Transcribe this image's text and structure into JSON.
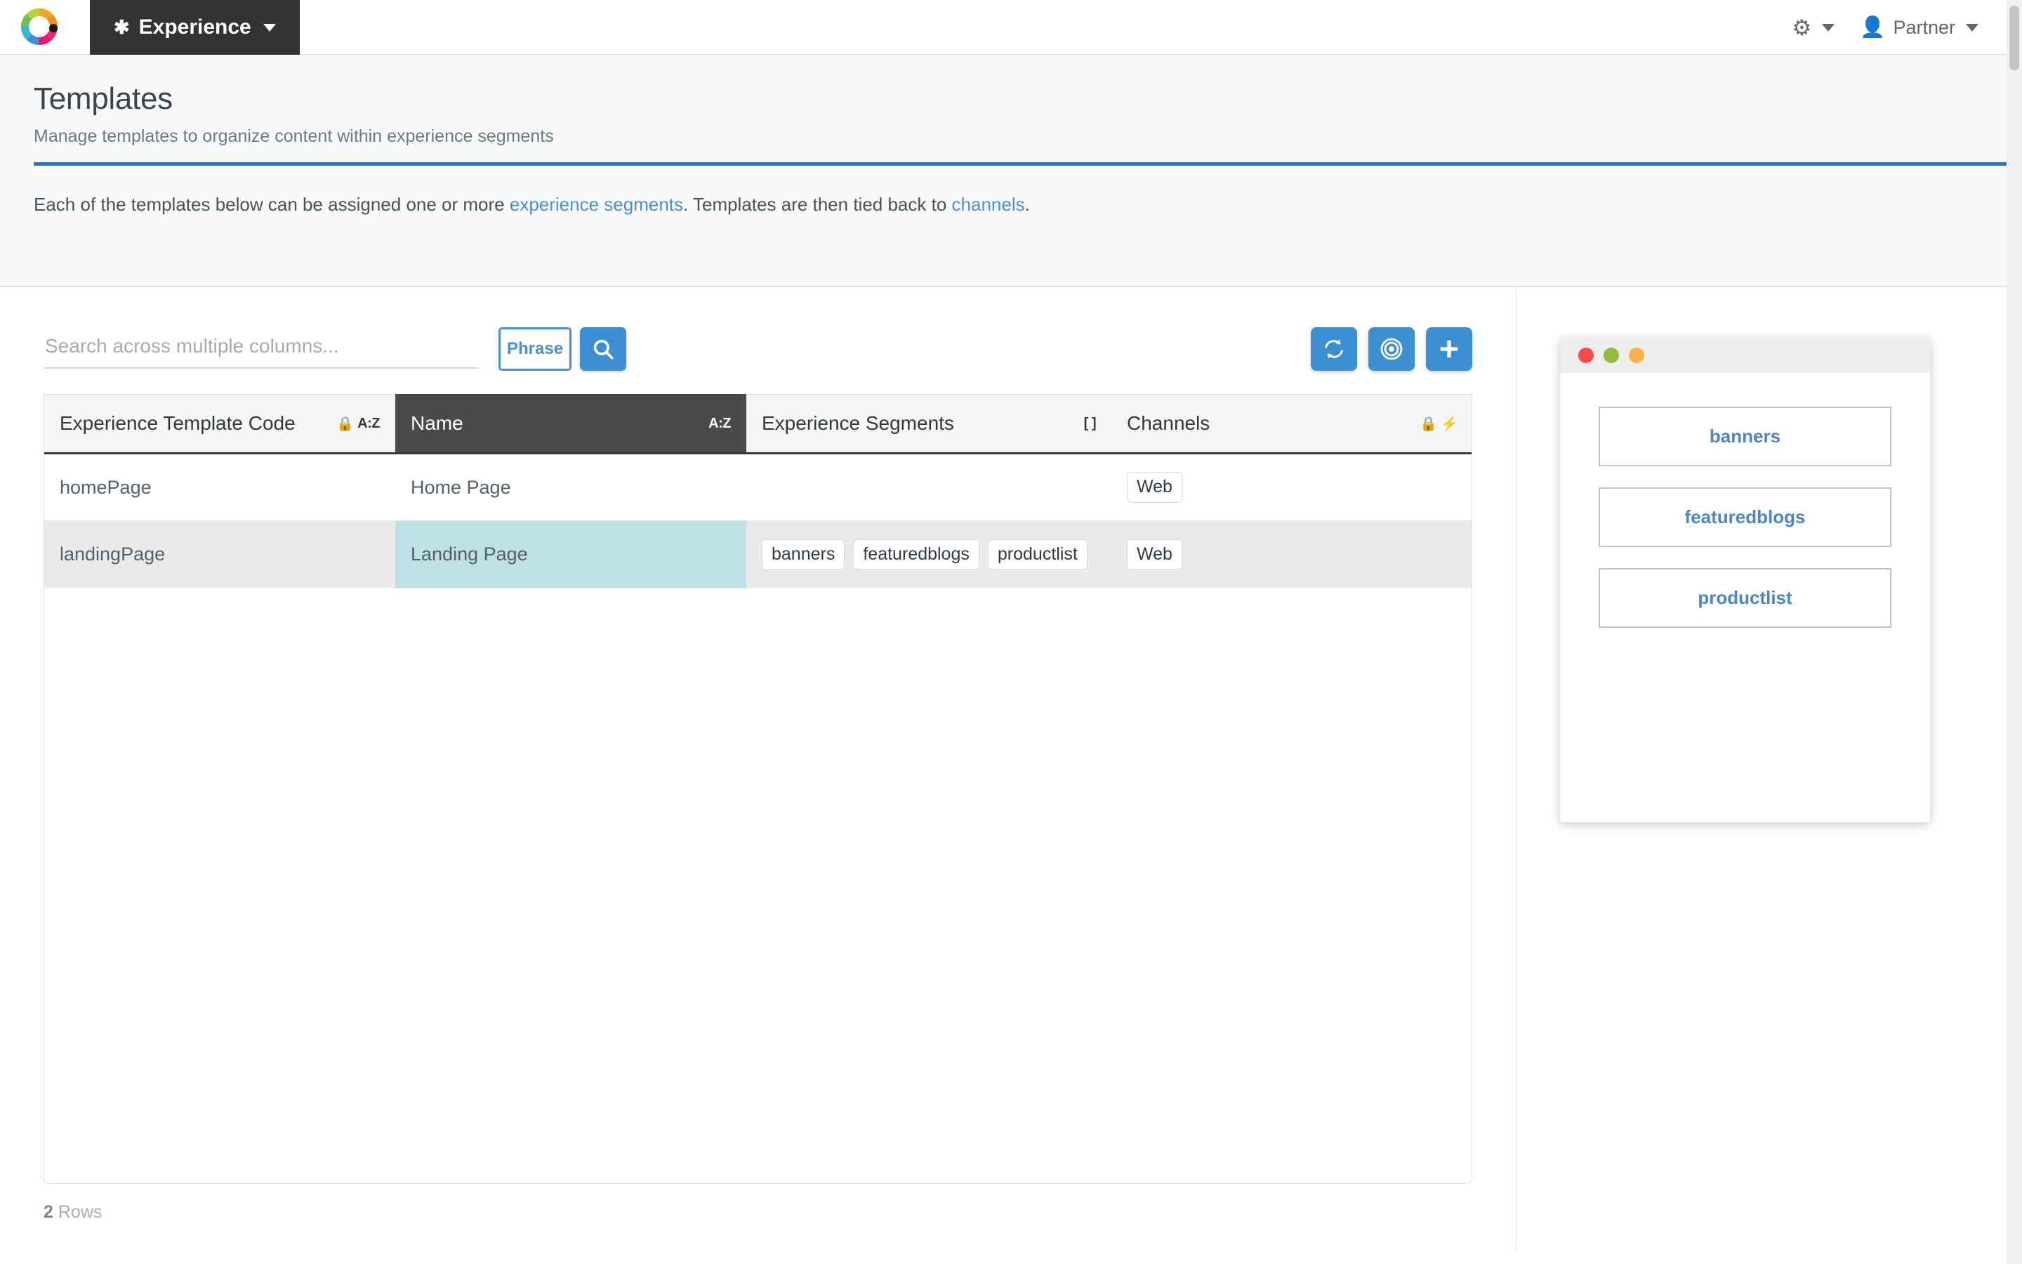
{
  "topnav": {
    "logo_icon": "color-wheel-logo",
    "tab": {
      "label": "Experience",
      "icon": "asterisk-icon"
    },
    "settings": {
      "icon": "gear-icon",
      "label": ""
    },
    "user": {
      "icon": "person-icon",
      "label": "Partner"
    }
  },
  "header": {
    "title": "Templates",
    "subtitle": "Manage templates to organize content within experience segments",
    "accent_color": "#1878cf",
    "intro": {
      "part1": "Each of the templates below can be assigned one or more ",
      "link1": "experience segments",
      "part2": ". Templates are then tied back to ",
      "link2": "channels",
      "part3": "."
    }
  },
  "toolbar": {
    "search_placeholder": "Search across multiple columns...",
    "search_value": "",
    "phrase_label": "Phrase",
    "search_icon": "search-icon",
    "buttons": [
      {
        "name": "refresh-button",
        "icon": "refresh-icon"
      },
      {
        "name": "target-button",
        "icon": "target-icon"
      },
      {
        "name": "add-button",
        "icon": "plus-icon"
      }
    ]
  },
  "table": {
    "columns": [
      {
        "label": "Experience Template Code",
        "marks": "lock+az",
        "az": "A:Z",
        "active": false
      },
      {
        "label": "Name",
        "marks": "az",
        "az": "A:Z",
        "active": true
      },
      {
        "label": "Experience Segments",
        "marks": "brackets",
        "az": "[ ]",
        "active": false
      },
      {
        "label": "Channels",
        "marks": "lock+bolt",
        "az": "",
        "active": false
      }
    ],
    "rows": [
      {
        "code": "homePage",
        "name": "Home Page",
        "segments": [],
        "channels": [
          "Web"
        ],
        "selected": false
      },
      {
        "code": "landingPage",
        "name": "Landing Page",
        "segments": [
          "banners",
          "featuredblogs",
          "productlist"
        ],
        "channels": [
          "Web"
        ],
        "selected": true
      }
    ],
    "footer_count": "2",
    "footer_label": "Rows"
  },
  "preview": {
    "window_dots": [
      "#f74b4b",
      "#95bb3a",
      "#f9b14a"
    ],
    "slots": [
      {
        "label": "banners"
      },
      {
        "label": "featuredblogs"
      },
      {
        "label": "productlist"
      }
    ]
  }
}
